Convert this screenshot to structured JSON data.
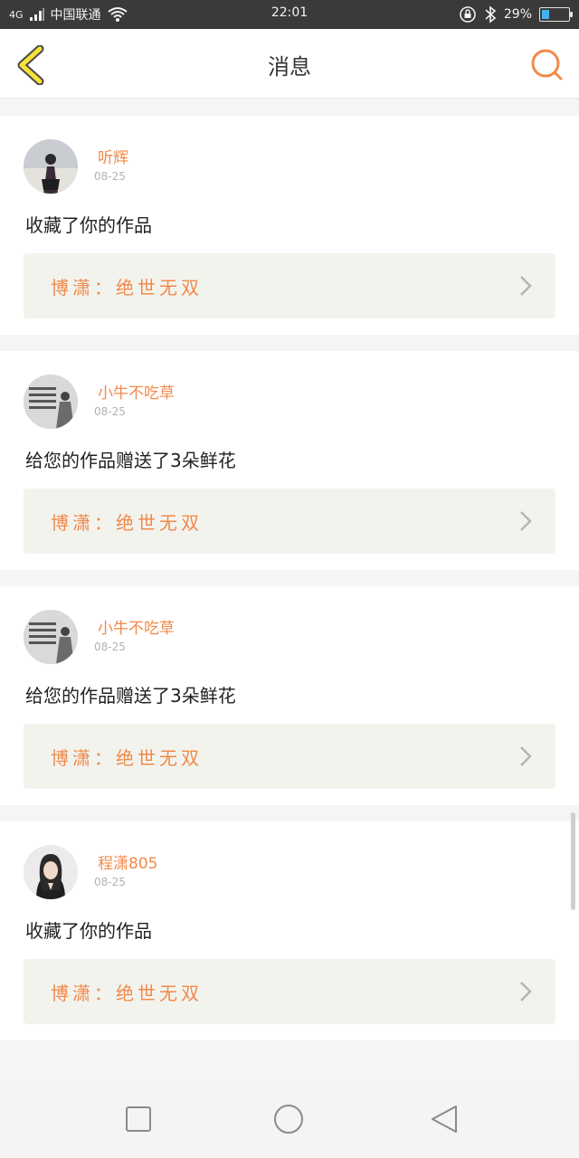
{
  "status_bar": {
    "network": "4G",
    "carrier": "中国联通",
    "time": "22:01",
    "battery_text": "29%",
    "battery_level": 0.29,
    "icons": [
      "signal-icon",
      "wifi-icon",
      "rotation-lock-icon",
      "bluetooth-icon",
      "battery-icon"
    ]
  },
  "header": {
    "title": "消息",
    "back_icon": "chevron-left-icon",
    "search_icon": "search-icon"
  },
  "colors": {
    "accent": "#f08a4b",
    "back_arrow_fill": "#f5e13a",
    "back_arrow_stroke": "#4a4a4a",
    "background": "#f6f5f5",
    "card": "#ffffff",
    "work_box": "#f3f3ee"
  },
  "messages": [
    {
      "user": "听辉",
      "date": "08-25",
      "text": "收藏了你的作品",
      "work": "博潇：绝世无双"
    },
    {
      "user": "小牛不吃草",
      "date": "08-25",
      "text": "给您的作品赠送了3朵鲜花",
      "work": "博潇：绝世无双"
    },
    {
      "user": "小牛不吃草",
      "date": "08-25",
      "text": "给您的作品赠送了3朵鲜花",
      "work": "博潇：绝世无双"
    },
    {
      "user": "程潇805",
      "date": "08-25",
      "text": "收藏了你的作品",
      "work": "博潇：绝世无双"
    }
  ],
  "nav_bar": {
    "icons": [
      "recent-apps-icon",
      "home-icon",
      "back-triangle-icon"
    ]
  }
}
